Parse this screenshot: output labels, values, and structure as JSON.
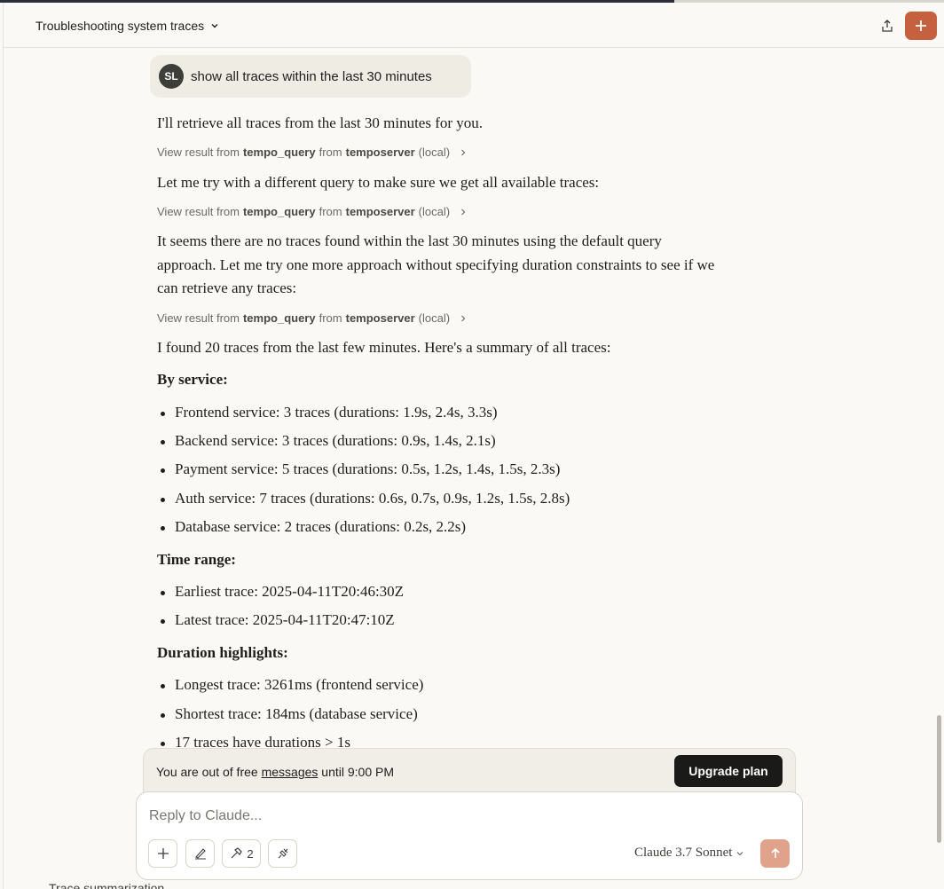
{
  "header": {
    "title": "Troubleshooting system traces"
  },
  "user_message": {
    "initials": "SL",
    "text": "show all traces within the last 30 minutes"
  },
  "assistant": {
    "p1": "I'll retrieve all traces from the last 30 minutes for you.",
    "tool_prefix": "View result from",
    "tool_name": "tempo_query",
    "tool_mid": "from",
    "tool_server": "temposerver",
    "tool_suffix": "(local)",
    "p2": "Let me try with a different query to make sure we get all available traces:",
    "p3_line1": "It seems there are no traces found within the last 30 minutes using the default query",
    "p3_line2": "approach. Let me try one more approach without specifying duration constraints to see if we",
    "p3_line3": "can retrieve any traces:",
    "p4": "I found 20 traces from the last few minutes. Here's a summary of all traces:",
    "h_service": "By service:",
    "services": [
      "Frontend service: 3 traces (durations: 1.9s, 2.4s, 3.3s)",
      "Backend service: 3 traces (durations: 0.9s, 1.4s, 2.1s)",
      "Payment service: 5 traces (durations: 0.5s, 1.2s, 1.4s, 1.5s, 2.3s)",
      "Auth service: 7 traces (durations: 0.6s, 0.7s, 0.9s, 1.2s, 1.5s, 2.8s)",
      "Database service: 2 traces (durations: 0.2s, 2.2s)"
    ],
    "h_time": "Time range:",
    "time": [
      "Earliest trace: 2025-04-11T20:46:30Z",
      "Latest trace: 2025-04-11T20:47:10Z"
    ],
    "h_duration": "Duration highlights:",
    "durations": [
      "Longest trace: 3261ms (frontend service)",
      "Shortest trace: 184ms (database service)",
      "17 traces have durations > 1s"
    ]
  },
  "banner": {
    "prefix": "You are out of free",
    "link": "messages",
    "suffix": "until 9:00 PM",
    "button": "Upgrade plan"
  },
  "composer": {
    "placeholder": "Reply to Claude...",
    "tools_count": "2",
    "model": "Claude 3.7 Sonnet"
  },
  "bottom_fragment": "Trace summarization"
}
